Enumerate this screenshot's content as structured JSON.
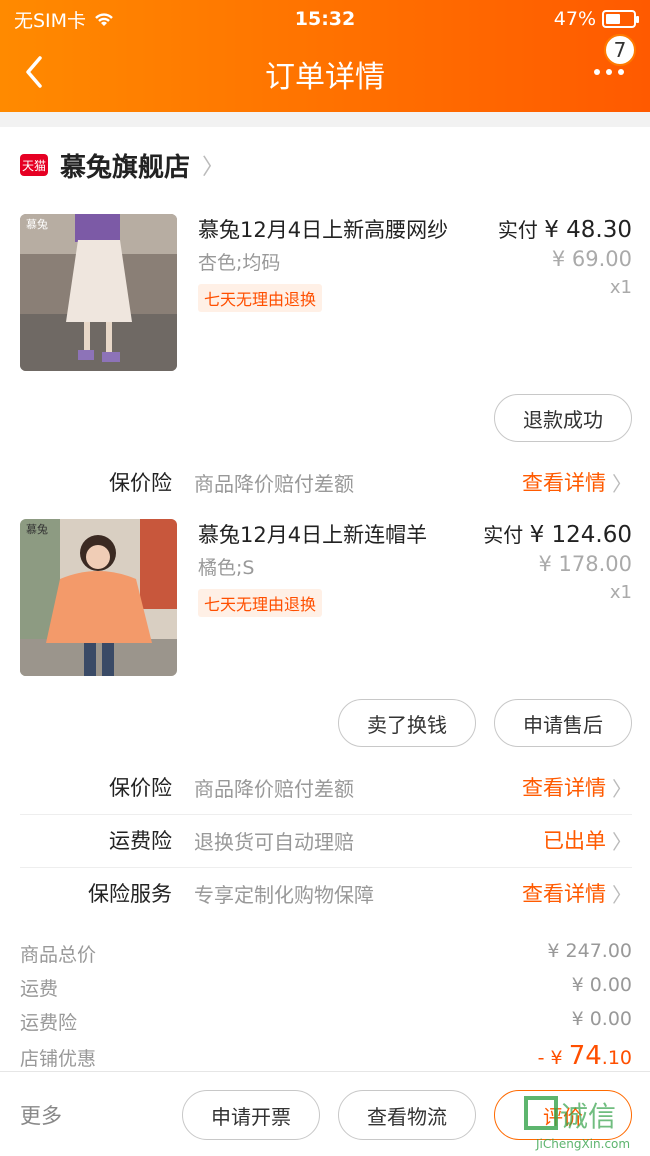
{
  "status_bar": {
    "carrier": "无SIM卡",
    "time": "15:32",
    "battery": "47%"
  },
  "header": {
    "title": "订单详情",
    "badge": "7"
  },
  "store": {
    "tag": "天猫",
    "name": "慕兔旗舰店"
  },
  "items": [
    {
      "name": "慕兔12月4日上新高腰网纱",
      "variant": "杏色;均码",
      "tag": "七天无理由退换",
      "actual_label": "实付",
      "actual_price": "¥ 48.30",
      "original_price": "¥ 69.00",
      "qty": "x1",
      "thumb_brand": "慕兔",
      "buttons": [
        "退款成功"
      ],
      "insurance": {
        "label": "保价险",
        "desc": "商品降价赔付差额",
        "action": "查看详情"
      }
    },
    {
      "name": "慕兔12月4日上新连帽羊",
      "variant": "橘色;S",
      "tag": "七天无理由退换",
      "actual_label": "实付",
      "actual_price": "¥ 124.60",
      "original_price": "¥ 178.00",
      "qty": "x1",
      "thumb_brand": "慕兔",
      "buttons": [
        "卖了换钱",
        "申请售后"
      ],
      "insurance": {
        "label": "保价险",
        "desc": "商品降价赔付差额",
        "action": "查看详情"
      }
    }
  ],
  "services": [
    {
      "label": "运费险",
      "desc": "退换货可自动理赔",
      "action": "已出单"
    },
    {
      "label": "保险服务",
      "desc": "专享定制化购物保障",
      "action": "查看详情"
    }
  ],
  "summary": [
    {
      "label": "商品总价",
      "value": "¥ 247.00"
    },
    {
      "label": "运费",
      "value": "¥ 0.00"
    },
    {
      "label": "运费险",
      "value": "¥ 0.00"
    },
    {
      "label": "店铺优惠",
      "prefix": "- ¥",
      "int": "74",
      "dec": ".10"
    }
  ],
  "bottom": {
    "more": "更多",
    "buttons": [
      "申请开票",
      "查看物流",
      "评价"
    ]
  },
  "watermark": {
    "cn": "诚信",
    "en": "JiChengXin.com"
  },
  "colors": {
    "accent": "#ff5a00",
    "header_start": "#ff8a00",
    "tmall_red": "#e60023"
  }
}
